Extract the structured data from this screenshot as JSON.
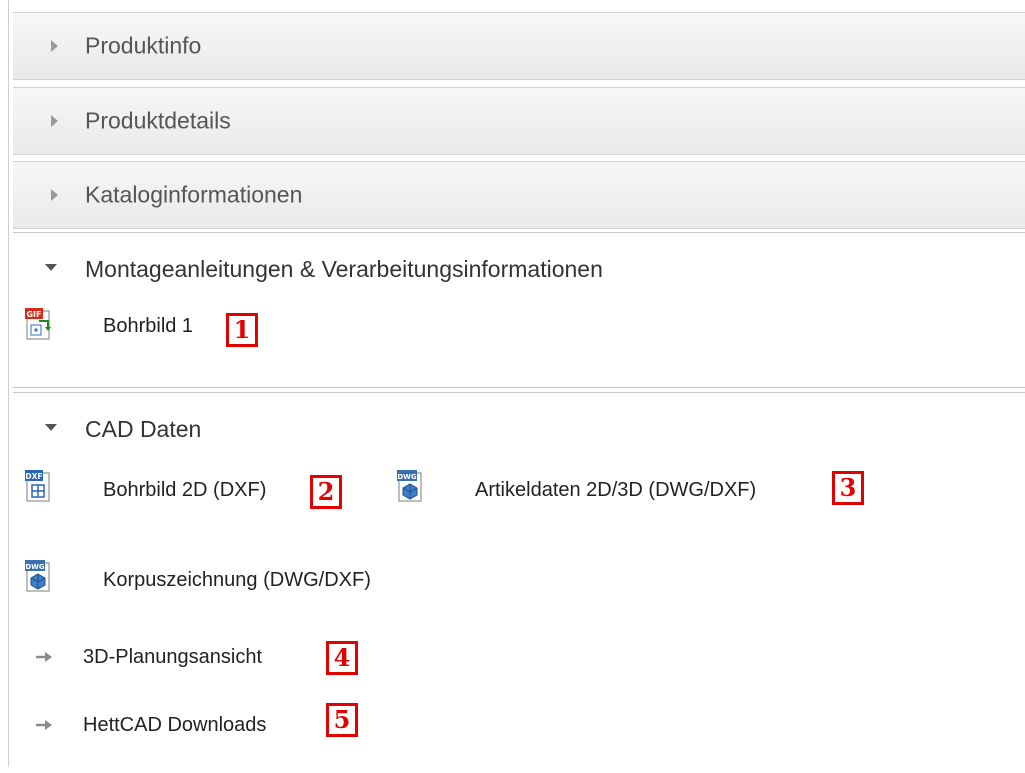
{
  "accordion": {
    "collapsed": [
      {
        "label": "Produktinfo"
      },
      {
        "label": "Produktdetails"
      },
      {
        "label": "Kataloginformationen"
      }
    ],
    "montage": {
      "title": "Montageanleitungen & Verarbeitungsinformationen",
      "items": [
        {
          "label": "Bohrbild 1",
          "icon": "gif-file-icon",
          "badge": "1"
        }
      ]
    },
    "cad": {
      "title": "CAD Daten",
      "files": [
        {
          "label": "Bohrbild 2D (DXF)",
          "icon": "dxf-file-icon",
          "badge": "2"
        },
        {
          "label": "Artikeldaten 2D/3D (DWG/DXF)",
          "icon": "dwg-file-icon",
          "badge": "3"
        },
        {
          "label": "Korpuszeichnung (DWG/DXF)",
          "icon": "dwg-file-icon"
        }
      ],
      "links": [
        {
          "label": "3D-Planungsansicht",
          "icon": "arrow-right-icon",
          "badge": "4"
        },
        {
          "label": "HettCAD Downloads",
          "icon": "arrow-right-icon",
          "badge": "5"
        }
      ]
    }
  },
  "colors": {
    "badge_red": "#e30000",
    "header_gray": "#ececec"
  }
}
